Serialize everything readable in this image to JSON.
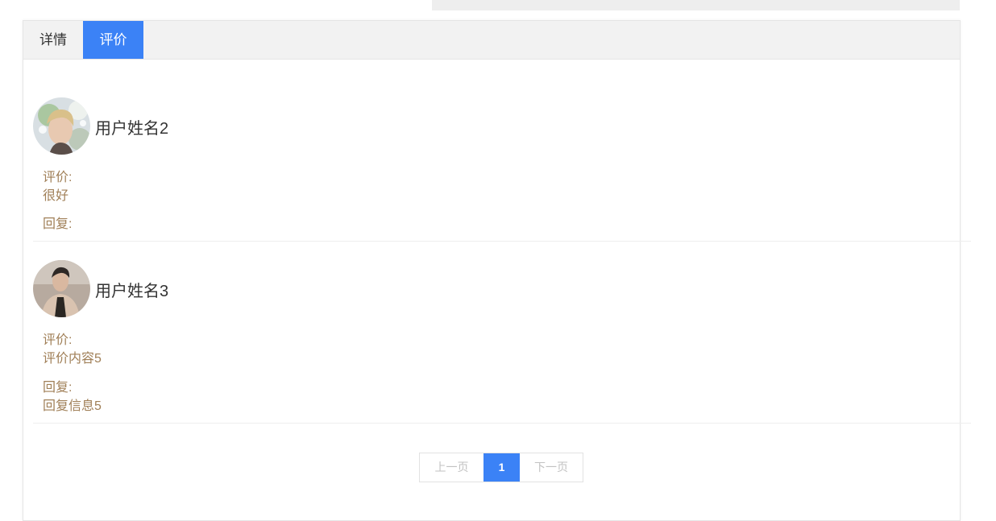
{
  "tabs": [
    {
      "label": "详情",
      "active": false
    },
    {
      "label": "评价",
      "active": true
    }
  ],
  "reviews": [
    {
      "username": "用户姓名2",
      "review_label": "评价:",
      "review_text": "很好",
      "reply_label": "回复:",
      "reply_text": ""
    },
    {
      "username": "用户姓名3",
      "review_label": "评价:",
      "review_text": "评价内容5",
      "reply_label": "回复:",
      "reply_text": "回复信息5"
    }
  ],
  "pagination": {
    "prev_label": "上一页",
    "current_page": "1",
    "next_label": "下一页"
  },
  "colors": {
    "accent": "#3b82f6",
    "label_text": "#a07f57",
    "tab_bar_bg": "#f2f2f2"
  }
}
